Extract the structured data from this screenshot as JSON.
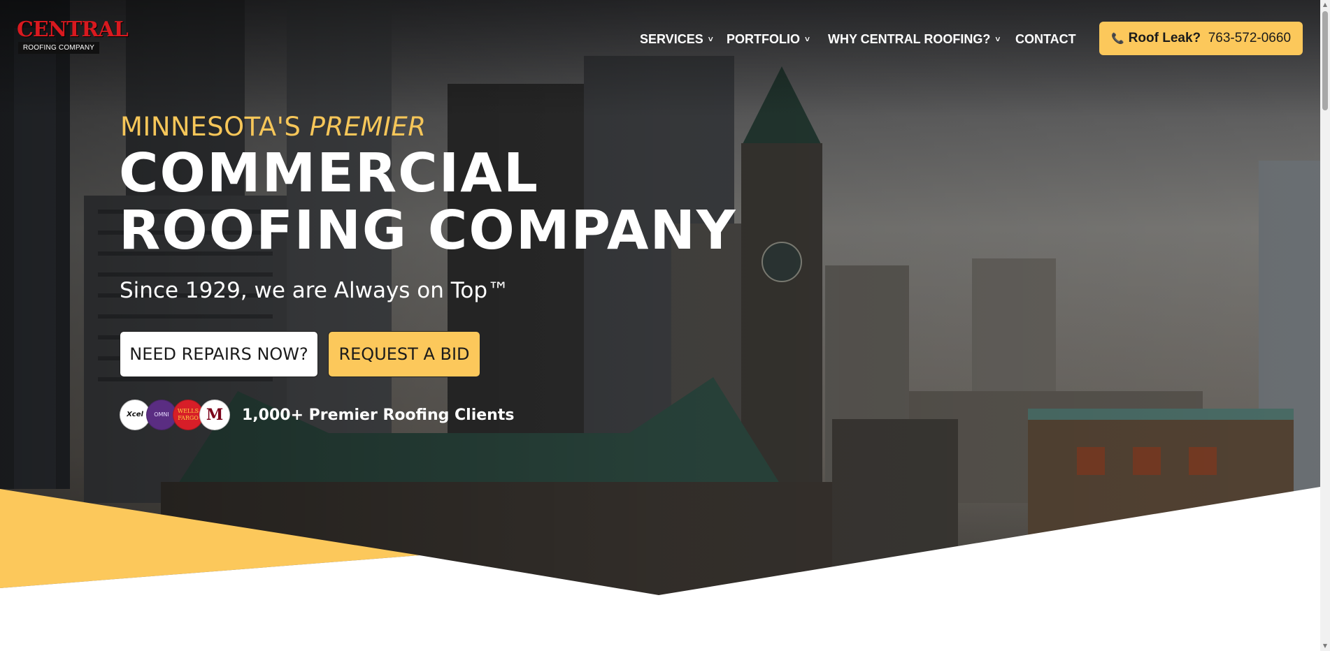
{
  "logo": {
    "top": "CENTRAL",
    "bottom": "ROOFING COMPANY"
  },
  "nav": {
    "items": [
      {
        "label": "SERVICES",
        "has_dropdown": true
      },
      {
        "label": "PORTFOLIO",
        "has_dropdown": true
      },
      {
        "label": "WHY CENTRAL ROOFING?",
        "has_dropdown": true
      },
      {
        "label": "CONTACT",
        "has_dropdown": false
      }
    ],
    "chevron": "˅"
  },
  "cta": {
    "icon": "phone-icon",
    "label": "Roof Leak?",
    "phone": "763-572-0660"
  },
  "hero": {
    "eyebrow_plain": "MINNESOTA'S",
    "eyebrow_italic": "PREMIER",
    "headline_line1": "COMMERCIAL",
    "headline_line2": "ROOFING COMPANY",
    "subline": "Since 1929, we are Always on Top™"
  },
  "buttons": {
    "repairs": "NEED REPAIRS NOW?",
    "bid": "REQUEST A BID"
  },
  "clients": {
    "logos": [
      {
        "name": "xcel-logo",
        "text": "Xcel"
      },
      {
        "name": "omni-logo",
        "text": "OMNI"
      },
      {
        "name": "wells-fargo-logo",
        "text": "WELLS FARGO"
      },
      {
        "name": "umn-logo",
        "text": "M"
      }
    ],
    "text": "1,000+ Premier Roofing Clients"
  },
  "colors": {
    "accent": "#fcc85b",
    "eyebrow": "#f6c659",
    "logo_red": "#d8191f"
  }
}
